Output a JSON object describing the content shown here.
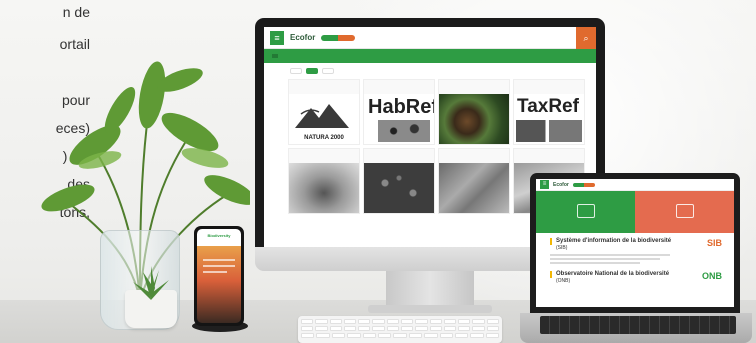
{
  "intro_text_lines": [
    "n de",
    "ortail",
    "",
    "pour",
    "eces)",
    ") est",
    "des",
    "tons,"
  ],
  "monitor": {
    "menu_icon": "menu-icon",
    "logo": "Ecofor",
    "logo_subtitle": "",
    "nav_tabs": [
      {
        "label": "",
        "active": true
      },
      {
        "label": "",
        "active": false
      },
      {
        "label": "",
        "active": false
      }
    ],
    "top_links": [
      "",
      ""
    ],
    "sub_tabs": [
      {
        "label": "",
        "active": false
      },
      {
        "label": "",
        "active": true
      },
      {
        "label": "",
        "active": false
      }
    ],
    "cards": [
      {
        "title": "",
        "image": "natura",
        "brand": "NATURA 2000"
      },
      {
        "title": "",
        "image": "habref",
        "brand": "HabRef"
      },
      {
        "title": "",
        "image": "macro",
        "brand": ""
      },
      {
        "title": "",
        "image": "taxref",
        "brand": "TaxRef"
      },
      {
        "title": "",
        "image": "grey1",
        "brand": ""
      },
      {
        "title": "",
        "image": "grey2",
        "brand": ""
      },
      {
        "title": "",
        "image": "grey3",
        "brand": ""
      },
      {
        "title": "",
        "image": "grey4",
        "brand": ""
      }
    ]
  },
  "laptop": {
    "logo": "Ecofor",
    "top_links": [
      "",
      ""
    ],
    "banners": [
      {
        "label": "",
        "color": "#2e9c44"
      },
      {
        "label": "",
        "color": "#e46b4f"
      }
    ],
    "sections": [
      {
        "title": "Système d'information de la biodiversité",
        "subtitle": "(SIB)",
        "badge": "SIB",
        "badge_color": "#e06a2e"
      },
      {
        "title": "Observatoire National de la biodiversité",
        "subtitle": "(ONB)",
        "badge": "ONB",
        "badge_color": "#2e9c44"
      }
    ]
  },
  "phone": {
    "title": "Biodiversity"
  },
  "colors": {
    "green": "#2e9c44",
    "orange": "#e06a2e",
    "salmon": "#e46b4f"
  }
}
